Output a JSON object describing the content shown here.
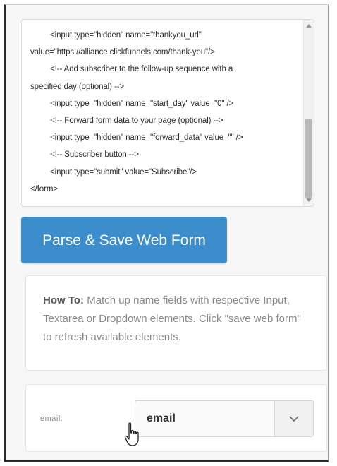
{
  "code_lines": [
    {
      "text": "<input type=\"hidden\" name=\"thankyou_url\"",
      "indent": true
    },
    {
      "text": "value=\"https://alliance.clickfunnels.com/thank-you\"/>",
      "indent": false
    },
    {
      "text": "<!-- Add subscriber to the follow-up sequence with a",
      "indent": true
    },
    {
      "text": "specified day (optional) -->",
      "indent": false
    },
    {
      "text": "<input type=\"hidden\" name=\"start_day\" value=\"0\" />",
      "indent": true
    },
    {
      "text": "<!-- Forward form data to your page (optional) -->",
      "indent": true
    },
    {
      "text": "<input type=\"hidden\" name=\"forward_data\" value=\"\" />",
      "indent": true
    },
    {
      "text": "<!-- Subscriber button -->",
      "indent": true
    },
    {
      "text": "<input type=\"submit\" value=\"Subscribe\"/>",
      "indent": true
    },
    {
      "text": "</form>",
      "indent": false
    }
  ],
  "parse_button": {
    "label": "Parse & Save Web Form"
  },
  "howto": {
    "bold": "How To:",
    "text": " Match up name fields with respective Input, Textarea or Dropdown elements. Click \"save web form\" to refresh available elements."
  },
  "field_mapping": {
    "label": "email:",
    "selected_value": "email"
  },
  "colors": {
    "accent": "#3b8dcc",
    "panel_bg": "#f6f6f6"
  },
  "icons": {
    "select_arrow": "chevron-down-icon",
    "cursor": "hand-pointer-icon"
  }
}
